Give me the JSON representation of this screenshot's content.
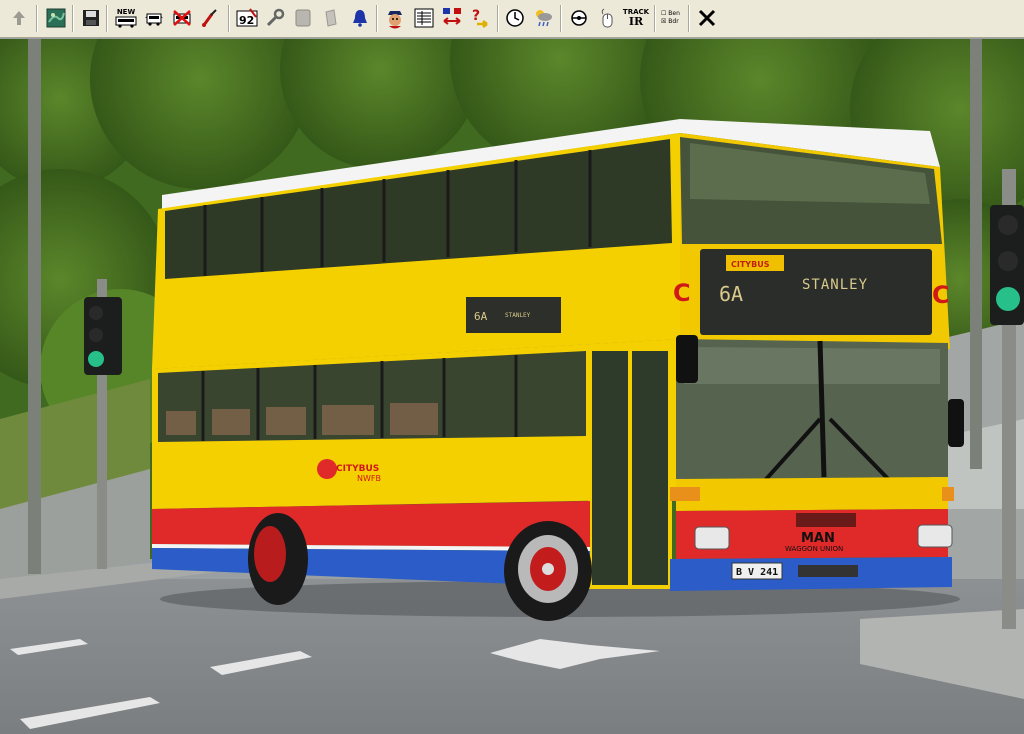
{
  "toolbar": {
    "buttons": [
      {
        "name": "up-arrow-icon"
      },
      {
        "name": "map-icon"
      },
      {
        "name": "save-icon"
      },
      {
        "name": "new-bus-icon",
        "label": "NEW"
      },
      {
        "name": "bus-icon"
      },
      {
        "name": "delete-bus-icon"
      },
      {
        "name": "paint-icon"
      },
      {
        "name": "line-number-icon",
        "label": "92"
      },
      {
        "name": "wrench-icon"
      },
      {
        "name": "ticket-icon"
      },
      {
        "name": "gray-ticket-icon"
      },
      {
        "name": "bell-icon"
      },
      {
        "name": "driver-icon"
      },
      {
        "name": "timetable-icon"
      },
      {
        "name": "swap-icon"
      },
      {
        "name": "help-icon"
      },
      {
        "name": "clock-icon"
      },
      {
        "name": "weather-icon"
      },
      {
        "name": "camera-icon"
      },
      {
        "name": "mouse-icon"
      },
      {
        "name": "track-ir-icon",
        "label1": "TRACK",
        "label2": "IR"
      },
      {
        "name": "option-toggle-icon",
        "label1": "Ben",
        "label2": "Bdr"
      },
      {
        "name": "close-icon"
      }
    ]
  },
  "scene": {
    "destination_route": "6A",
    "destination_text": "STANLEY",
    "side_route": "6A",
    "side_text": "STANLEY",
    "fleet_number": "241",
    "operator": "CITYBUS",
    "operator_tag": "NWFB",
    "manufacturer": "MAN",
    "bodybuilder": "WAGGON UNION",
    "plate": "B V 241"
  }
}
